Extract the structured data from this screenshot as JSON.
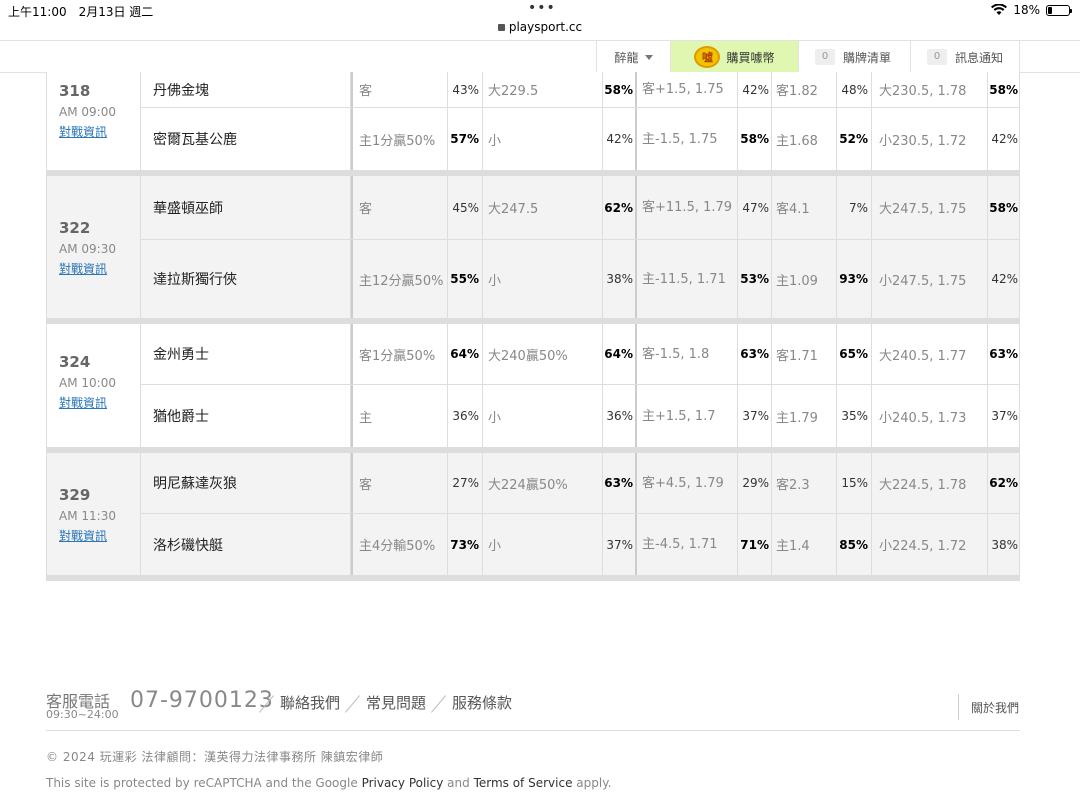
{
  "status": {
    "time": "上午11:00　2月13日 週二",
    "battery": "18%",
    "battery_level": 0.18,
    "url": "playsport.cc"
  },
  "nav": {
    "user": "醉龍",
    "coin_icon": "噓",
    "buy": "購買噱幣",
    "cart_count": "0",
    "cart": "購牌清單",
    "msg_count": "0",
    "msg": "訊息通知"
  },
  "link_label": "對戰資訊",
  "games": [
    {
      "num": "318",
      "time": "AM 09:00",
      "rows": [
        {
          "team": "丹佛金塊",
          "spread": "客",
          "p1": "43%",
          "total": "大229.5",
          "p2": "58%",
          "line": "客+1.5, 1.75",
          "p3": "42%",
          "ml": "客1.82",
          "p4": "48%",
          "ou": "大230.5, 1.78",
          "p5": "58%"
        },
        {
          "team": "密爾瓦基公鹿",
          "spread": "主1分贏50%",
          "p1": "57%",
          "total": "小",
          "p2": "42%",
          "line": "主-1.5, 1.75",
          "p3": "58%",
          "ml": "主1.68",
          "p4": "52%",
          "ou": "小230.5, 1.72",
          "p5": "42%"
        }
      ]
    },
    {
      "num": "322",
      "time": "AM 09:30",
      "rows": [
        {
          "team": "華盛頓巫師",
          "spread": "客",
          "p1": "45%",
          "total": "大247.5",
          "p2": "62%",
          "line": "客+11.5, 1.79",
          "p3": "47%",
          "ml": "客4.1",
          "p4": "7%",
          "ou": "大247.5, 1.75",
          "p5": "58%"
        },
        {
          "team": "達拉斯獨行俠",
          "spread": "主12分贏50%",
          "p1": "55%",
          "total": "小",
          "p2": "38%",
          "line": "主-11.5, 1.71",
          "p3": "53%",
          "ml": "主1.09",
          "p4": "93%",
          "ou": "小247.5, 1.75",
          "p5": "42%"
        }
      ]
    },
    {
      "num": "324",
      "time": "AM 10:00",
      "rows": [
        {
          "team": "金州勇士",
          "spread": "客1分贏50%",
          "p1": "64%",
          "total": "大240贏50%",
          "p2": "64%",
          "line": "客-1.5, 1.8",
          "p3": "63%",
          "ml": "客1.71",
          "p4": "65%",
          "ou": "大240.5, 1.77",
          "p5": "63%"
        },
        {
          "team": "猶他爵士",
          "spread": "主",
          "p1": "36%",
          "total": "小",
          "p2": "36%",
          "line": "主+1.5, 1.7",
          "p3": "37%",
          "ml": "主1.79",
          "p4": "35%",
          "ou": "小240.5, 1.73",
          "p5": "37%"
        }
      ]
    },
    {
      "num": "329",
      "time": "AM 11:30",
      "rows": [
        {
          "team": "明尼蘇達灰狼",
          "spread": "客",
          "p1": "27%",
          "total": "大224贏50%",
          "p2": "63%",
          "line": "客+4.5, 1.79",
          "p3": "29%",
          "ml": "客2.3",
          "p4": "15%",
          "ou": "大224.5, 1.78",
          "p5": "62%"
        },
        {
          "team": "洛杉磯快艇",
          "spread": "主4分輸50%",
          "p1": "73%",
          "total": "小",
          "p2": "37%",
          "line": "主-4.5, 1.71",
          "p3": "71%",
          "ml": "主1.4",
          "p4": "85%",
          "ou": "小224.5, 1.72",
          "p5": "38%"
        }
      ]
    }
  ],
  "footer": {
    "service_label": "客服電話",
    "service_hours": "09:30~24:00",
    "phone": "07-9700123",
    "links": [
      "聯絡我們",
      "常見問題",
      "服務條款"
    ],
    "about": "關於我們",
    "copyright": "© 2024 玩運彩 法律顧問：漢英得力法律事務所 陳鎮宏律師",
    "recaptcha_pre": "This site is protected by reCAPTCHA and the Google ",
    "privacy": "Privacy Policy",
    "and": " and ",
    "terms": "Terms of Service",
    "apply": " apply."
  }
}
